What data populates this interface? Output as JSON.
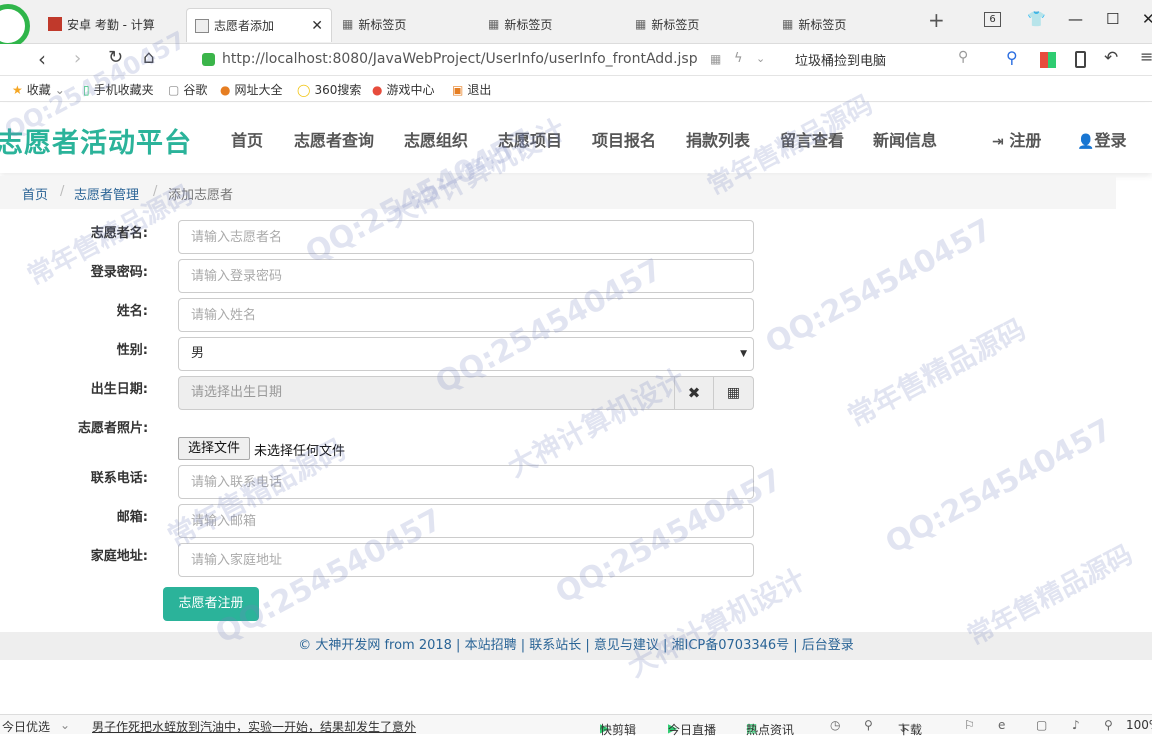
{
  "browser": {
    "tabs": [
      {
        "label": "安卓 考勤 - 计算"
      },
      {
        "label": "志愿者添加"
      },
      {
        "label": "新标签页"
      },
      {
        "label": "新标签页"
      },
      {
        "label": "新标签页"
      },
      {
        "label": "新标签页"
      }
    ],
    "tab_count": "6",
    "url": "http://localhost:8080/JavaWebProject/UserInfo/userInfo_frontAdd.jsp",
    "search_hint": "垃圾桶捡到电脑",
    "bookmarks": [
      "收藏",
      "手机收藏夹",
      "谷歌",
      "网址大全",
      "360搜索",
      "游戏中心",
      "退出"
    ]
  },
  "site": {
    "brand": "志愿者活动平台",
    "nav": [
      "首页",
      "志愿者查询",
      "志愿组织",
      "志愿项目",
      "项目报名",
      "捐款列表",
      "留言查看",
      "新闻信息"
    ],
    "register": "注册",
    "login": "登录"
  },
  "breadcrumb": {
    "home": "首页",
    "section": "志愿者管理",
    "current": "添加志愿者"
  },
  "form": {
    "name_label": "志愿者名:",
    "name_placeholder": "请输入志愿者名",
    "pwd_label": "登录密码:",
    "pwd_placeholder": "请输入登录密码",
    "realname_label": "姓名:",
    "realname_placeholder": "请输入姓名",
    "gender_label": "性别:",
    "gender_value": "男",
    "birth_label": "出生日期:",
    "birth_placeholder": "请选择出生日期",
    "photo_label": "志愿者照片:",
    "file_button": "选择文件",
    "file_status": "未选择任何文件",
    "phone_label": "联系电话:",
    "phone_placeholder": "请输入联系电话",
    "email_label": "邮箱:",
    "email_placeholder": "请输入邮箱",
    "address_label": "家庭地址:",
    "address_placeholder": "请输入家庭地址",
    "submit": "志愿者注册"
  },
  "footer": {
    "text": "© 大神开发网 from 2018 | 本站招聘 | 联系站长 | 意见与建议 | 湘ICP备0703346号 | 后台登录"
  },
  "statusbar": {
    "news_prefix": "今日优选",
    "news": "男子作死把水蛭放到汽油中，实验一开始，结果却发生了意外",
    "items": [
      "快剪辑",
      "今日直播",
      "热点资讯",
      "下载",
      "100%"
    ]
  },
  "watermark": {
    "qq": "QQ:254540457",
    "slogan1": "常年售精品源码",
    "slogan2": "大神计算机设计"
  },
  "colors": {
    "accent": "#2bb39a",
    "link": "#2a6496"
  }
}
